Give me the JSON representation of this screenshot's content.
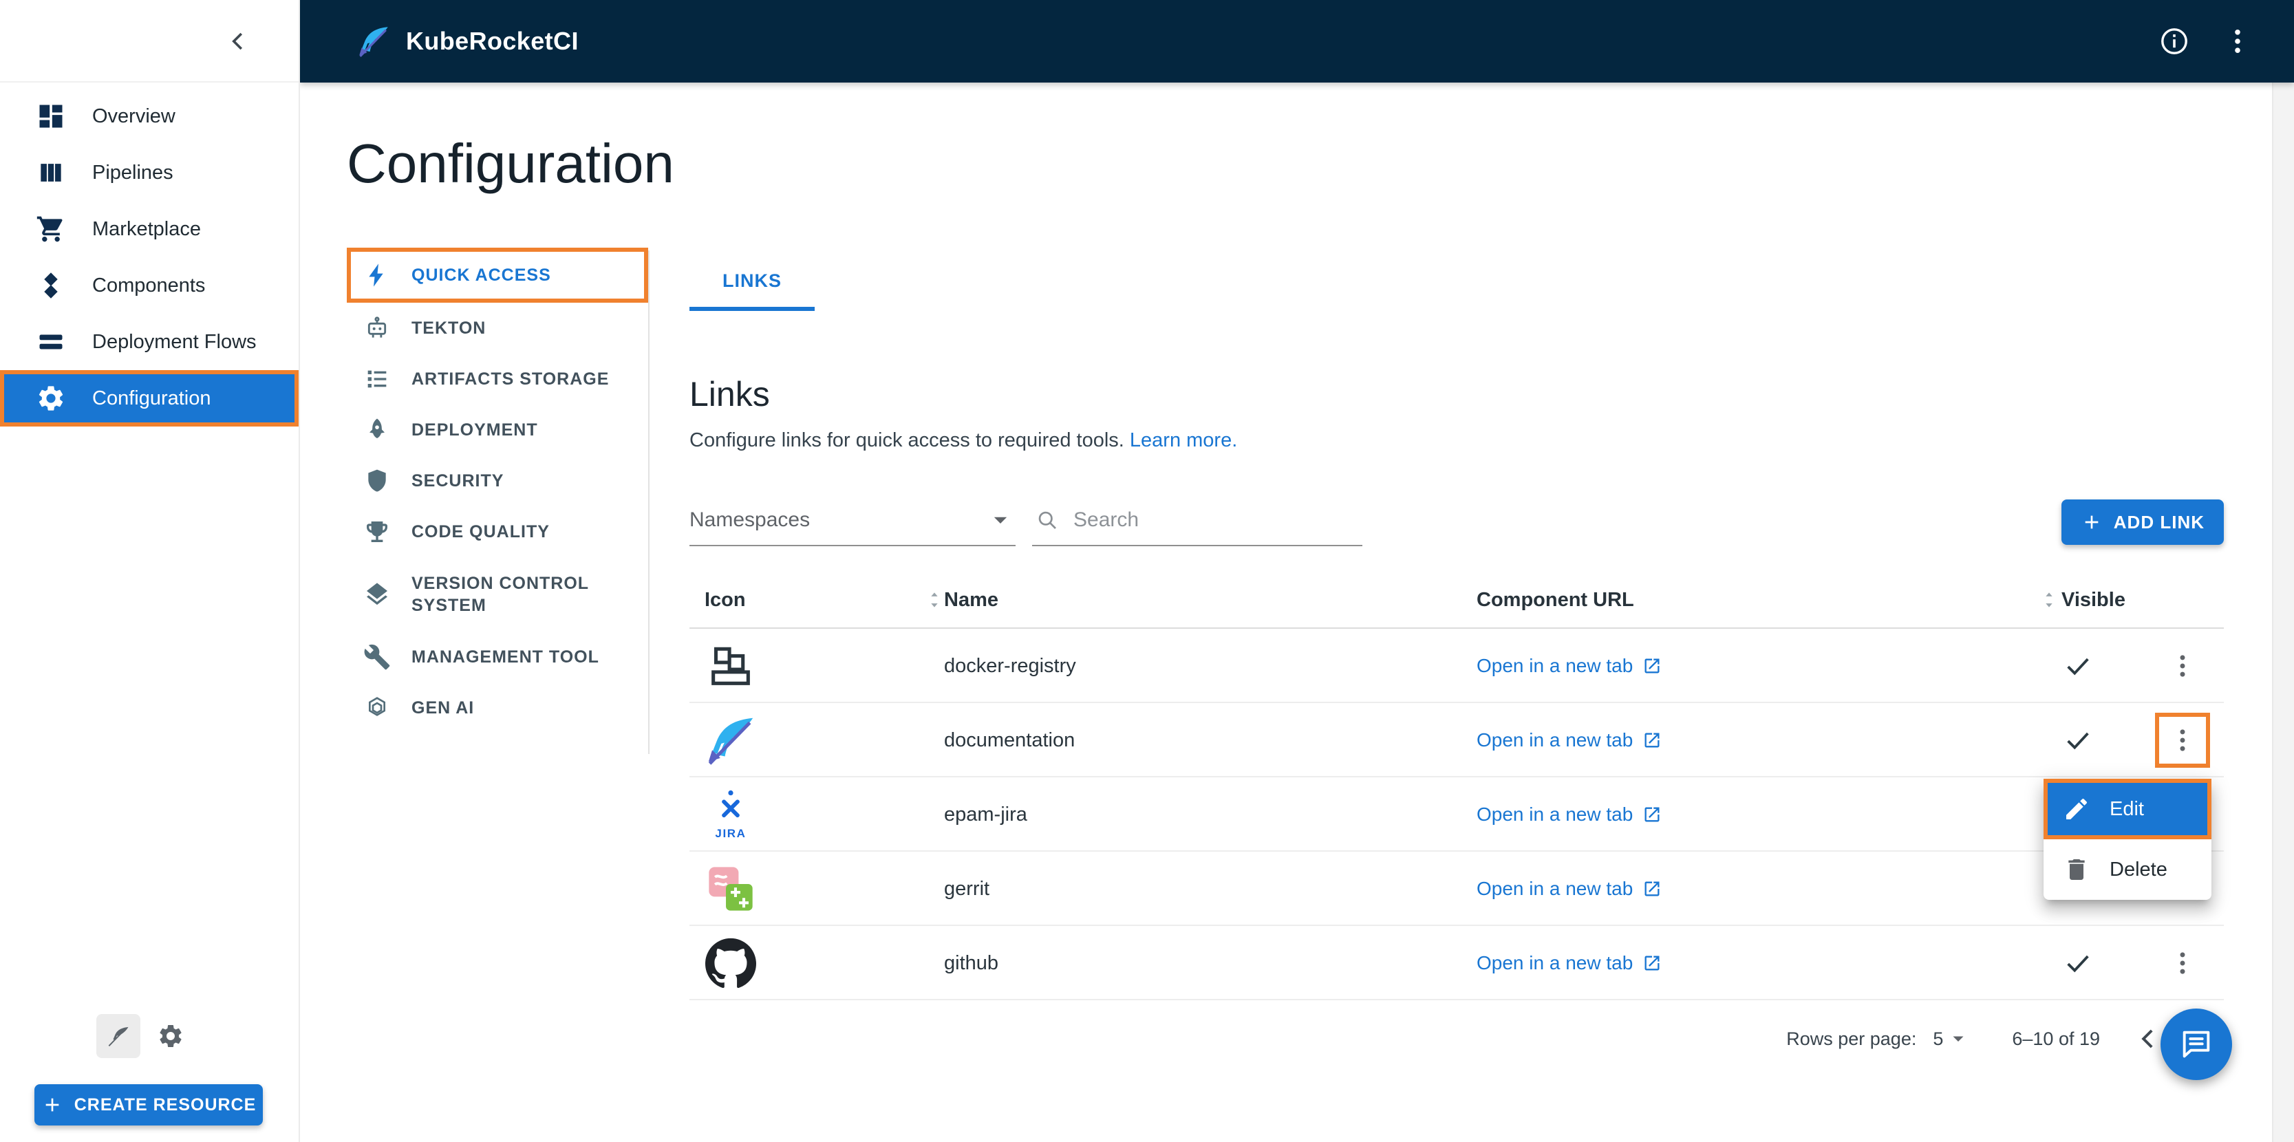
{
  "colors": {
    "header_bg": "#04263f",
    "primary": "#1976d2",
    "annotation": "#f0812e",
    "link": "#1976d2"
  },
  "header": {
    "app_title": "KubeRocketCI",
    "icons": [
      "kuberocketci-logo-feather-icon",
      "info-icon",
      "kebab-menu-icon"
    ]
  },
  "sidebar": {
    "collapse_icon": "chevron-left-icon",
    "items": [
      {
        "label": "Overview",
        "icon": "dashboard-icon",
        "selected": false
      },
      {
        "label": "Pipelines",
        "icon": "pipelines-icon",
        "selected": false
      },
      {
        "label": "Marketplace",
        "icon": "cart-icon",
        "selected": false
      },
      {
        "label": "Components",
        "icon": "components-icon",
        "selected": false
      },
      {
        "label": "Deployment Flows",
        "icon": "deployment-flows-icon",
        "selected": false
      },
      {
        "label": "Configuration",
        "icon": "gear-icon",
        "selected": true,
        "annotated": true
      }
    ],
    "footer_icons": [
      "pen-icon",
      "gear-icon"
    ],
    "create_button": {
      "label": "CREATE RESOURCE",
      "icon": "plus-icon"
    }
  },
  "page": {
    "title": "Configuration"
  },
  "config_nav": {
    "items": [
      {
        "label": "QUICK ACCESS",
        "icon": "bolt-icon",
        "selected": true,
        "annotated": true
      },
      {
        "label": "TEKTON",
        "icon": "robot-icon",
        "selected": false
      },
      {
        "label": "ARTIFACTS STORAGE",
        "icon": "storage-list-icon",
        "selected": false
      },
      {
        "label": "DEPLOYMENT",
        "icon": "rocket-icon",
        "selected": false
      },
      {
        "label": "SECURITY",
        "icon": "shield-icon",
        "selected": false
      },
      {
        "label": "CODE QUALITY",
        "icon": "trophy-icon",
        "selected": false
      },
      {
        "label": "VERSION CONTROL SYSTEM",
        "icon": "layers-icon",
        "selected": false
      },
      {
        "label": "MANAGEMENT TOOL",
        "icon": "wrench-icon",
        "selected": false
      },
      {
        "label": "GEN AI",
        "icon": "genai-icon",
        "selected": false
      }
    ]
  },
  "tabs": [
    {
      "label": "LINKS",
      "selected": true
    }
  ],
  "links_section": {
    "heading": "Links",
    "description": "Configure links for quick access to required tools.",
    "learn_more_label": "Learn more."
  },
  "toolbar": {
    "namespaces_label": "Namespaces",
    "search_placeholder": "Search",
    "search_icon": "search-icon",
    "add_link_label": "ADD LINK"
  },
  "table": {
    "columns": [
      {
        "label": "Icon",
        "sortable": true
      },
      {
        "label": "Name",
        "sortable": false
      },
      {
        "label": "Component URL",
        "sortable": false
      },
      {
        "label": "Visible",
        "sortable": true
      }
    ],
    "open_link_label": "Open in a new tab",
    "rows": [
      {
        "name": "docker-registry",
        "icon": "docker-registry-icon",
        "visible": true
      },
      {
        "name": "documentation",
        "icon": "kuberocketci-feather-icon",
        "visible": true,
        "kebab_annotated": true
      },
      {
        "name": "epam-jira",
        "icon": "jira-icon",
        "jira_text": "JIRA",
        "visible": true
      },
      {
        "name": "gerrit",
        "icon": "gerrit-icon",
        "visible": true
      },
      {
        "name": "github",
        "icon": "github-icon",
        "visible": true
      }
    ]
  },
  "context_menu": {
    "items": [
      {
        "label": "Edit",
        "icon": "pencil-icon",
        "selected": true,
        "annotated": true
      },
      {
        "label": "Delete",
        "icon": "trash-icon",
        "selected": false
      }
    ]
  },
  "pagination": {
    "rows_per_page_label": "Rows per page:",
    "rows_per_page_value": "5",
    "range_label": "6–10 of 19",
    "prev_icon": "chevron-left-icon",
    "next_icon": "chevron-right-icon"
  },
  "fab": {
    "icon": "chat-icon"
  }
}
